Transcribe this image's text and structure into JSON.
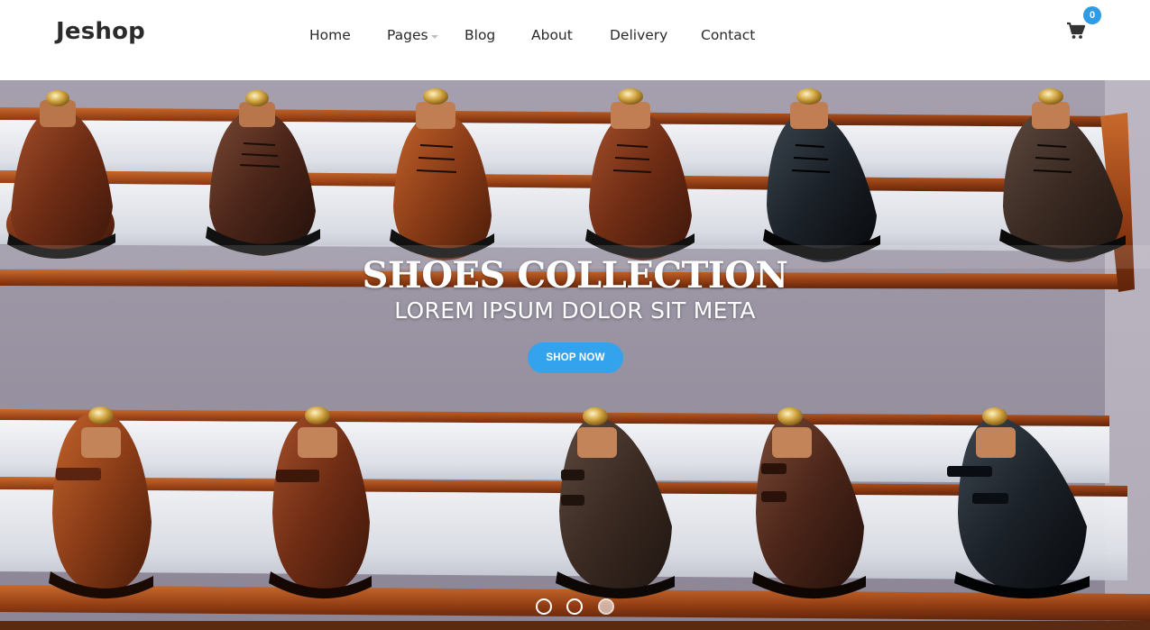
{
  "header": {
    "logo": "Jeshop",
    "nav": [
      {
        "label": "Home"
      },
      {
        "label": "Pages"
      },
      {
        "label": "Blog"
      },
      {
        "label": "About"
      },
      {
        "label": "Delivery"
      },
      {
        "label": "Contact"
      }
    ],
    "cart_count": "0",
    "cart_icon": "shopping-cart-icon"
  },
  "hero": {
    "title": "SHOES COLLECTION",
    "subtitle": "LOREM IPSUM DOLOR SIT META",
    "button_label": "SHOP NOW",
    "slides_total": 3,
    "active_slide": 3
  },
  "colors": {
    "accent": "#33a3ee",
    "badge": "#2e9be6",
    "text": "#2a2a2a"
  }
}
